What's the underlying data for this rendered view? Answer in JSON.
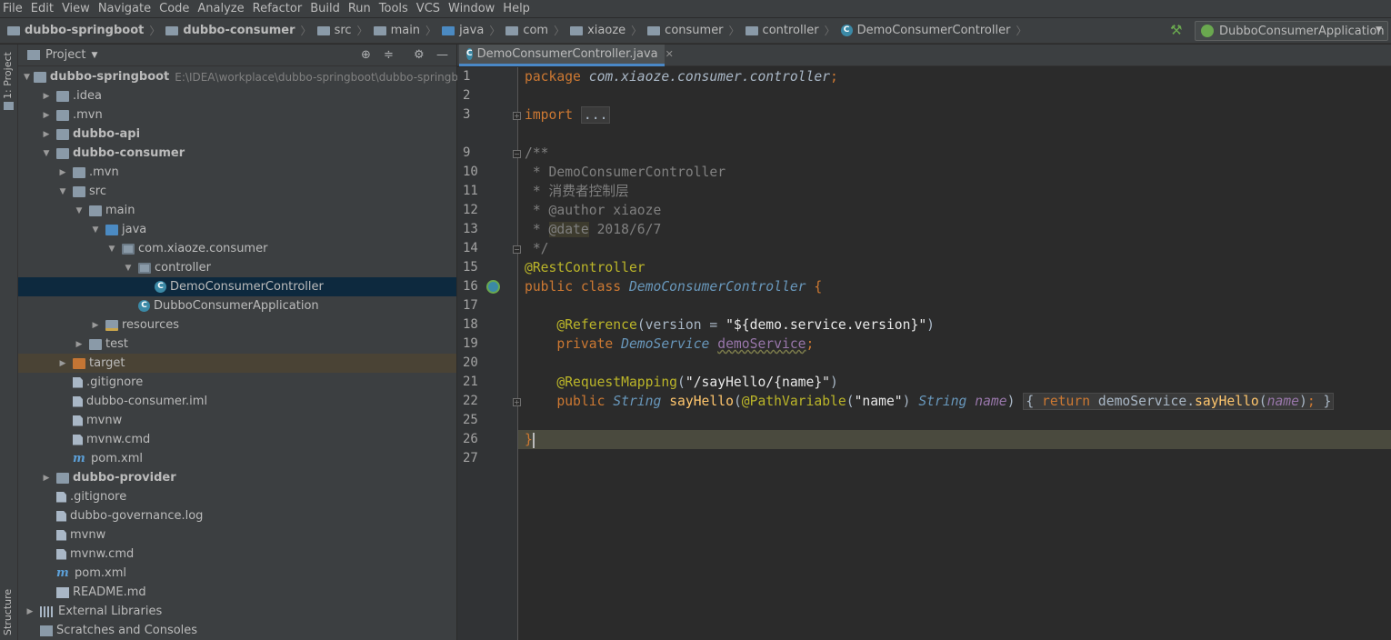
{
  "menu": [
    "File",
    "Edit",
    "View",
    "Navigate",
    "Code",
    "Analyze",
    "Refactor",
    "Build",
    "Run",
    "Tools",
    "VCS",
    "Window",
    "Help"
  ],
  "breadcrumbs": [
    "dubbo-springboot",
    "dubbo-consumer",
    "src",
    "main",
    "java",
    "com",
    "xiaoze",
    "consumer",
    "controller",
    "DemoConsumerController"
  ],
  "run_config": "DubboConsumerApplication",
  "left_stripe": {
    "project_tab": "1: Project",
    "structure_tab": "Structure"
  },
  "project_panel": {
    "title": "Project",
    "root_path": "E:\\IDEA\\workplace\\dubbo-springboot\\dubbo-springboo",
    "tree": [
      {
        "label": "dubbo-springboot",
        "bold": true,
        "icon": "module-folder",
        "toggle": "expanded"
      },
      {
        "label": ".idea",
        "icon": "folder",
        "toggle": "collapsed"
      },
      {
        "label": ".mvn",
        "icon": "folder",
        "toggle": "collapsed"
      },
      {
        "label": "dubbo-api",
        "bold": true,
        "icon": "module-folder",
        "toggle": "collapsed"
      },
      {
        "label": "dubbo-consumer",
        "bold": true,
        "icon": "module-folder",
        "toggle": "expanded"
      },
      {
        "label": ".mvn",
        "icon": "folder",
        "toggle": "collapsed"
      },
      {
        "label": "src",
        "icon": "folder",
        "toggle": "expanded"
      },
      {
        "label": "main",
        "icon": "folder",
        "toggle": "expanded"
      },
      {
        "label": "java",
        "icon": "source-folder",
        "toggle": "expanded"
      },
      {
        "label": "com.xiaoze.consumer",
        "icon": "package",
        "toggle": "expanded"
      },
      {
        "label": "controller",
        "icon": "package",
        "toggle": "expanded"
      },
      {
        "label": "DemoConsumerController",
        "icon": "class",
        "selected": true
      },
      {
        "label": "DubboConsumerApplication",
        "icon": "class"
      },
      {
        "label": "resources",
        "icon": "resources-folder",
        "toggle": "collapsed"
      },
      {
        "label": "test",
        "icon": "folder",
        "toggle": "collapsed"
      },
      {
        "label": "target",
        "icon": "excluded-folder",
        "toggle": "collapsed",
        "highlight": true
      },
      {
        "label": ".gitignore",
        "icon": "file"
      },
      {
        "label": "dubbo-consumer.iml",
        "icon": "file"
      },
      {
        "label": "mvnw",
        "icon": "file"
      },
      {
        "label": "mvnw.cmd",
        "icon": "file"
      },
      {
        "label": "pom.xml",
        "icon": "maven"
      },
      {
        "label": "dubbo-provider",
        "bold": true,
        "icon": "module-folder",
        "toggle": "collapsed"
      },
      {
        "label": ".gitignore",
        "icon": "file"
      },
      {
        "label": "dubbo-governance.log",
        "icon": "file"
      },
      {
        "label": "mvnw",
        "icon": "file"
      },
      {
        "label": "mvnw.cmd",
        "icon": "file"
      },
      {
        "label": "pom.xml",
        "icon": "maven"
      },
      {
        "label": "README.md",
        "icon": "markdown"
      },
      {
        "label": "External Libraries",
        "icon": "libraries",
        "toggle": "collapsed"
      },
      {
        "label": "Scratches and Consoles",
        "icon": "scratches"
      }
    ]
  },
  "editor": {
    "tab_label": "DemoConsumerController.java",
    "current_line": "26",
    "lines": [
      {
        "n": "1"
      },
      {
        "n": "2"
      },
      {
        "n": "3"
      },
      {
        "n": "9"
      },
      {
        "n": "10"
      },
      {
        "n": "11"
      },
      {
        "n": "12"
      },
      {
        "n": "13"
      },
      {
        "n": "14"
      },
      {
        "n": "15"
      },
      {
        "n": "16"
      },
      {
        "n": "17"
      },
      {
        "n": "18"
      },
      {
        "n": "19"
      },
      {
        "n": "20"
      },
      {
        "n": "21"
      },
      {
        "n": "22"
      },
      {
        "n": "25"
      },
      {
        "n": "26"
      },
      {
        "n": "27"
      }
    ],
    "code": {
      "l1_kw": "package",
      "l1_pkg": "com.xiaoze.consumer.controller",
      "l1_semi": ";",
      "l3_kw": "import",
      "l3_fold": "...",
      "l9": "/**",
      "l10": " * DemoConsumerController",
      "l11": " * 消费者控制层",
      "l12": " * @author xiaoze",
      "l13_pre": " * ",
      "l13_tag": "@date",
      "l13_post": " 2018/6/7",
      "l14": " */",
      "l15": "@RestController",
      "l16_kw": "public class",
      "l16_cls": "DemoConsumerController",
      "l16_brace": " {",
      "l18_an": "@Reference",
      "l18_open": "(version = ",
      "l18_str": "\"${demo.service.version}\"",
      "l18_close": ")",
      "l19_kw": "private",
      "l19_type": "DemoService",
      "l19_field": "demoService",
      "l19_semi": ";",
      "l21_an": "@RequestMapping",
      "l21_open": "(",
      "l21_str": "\"/sayHello/{name}\"",
      "l21_close": ")",
      "l22_kw": "public",
      "l22_type": "String",
      "l22_fn": "sayHello",
      "l22_an": "@PathVariable",
      "l22_str": "\"name\"",
      "l22_type2": "String",
      "l22_par": "name",
      "l22_ret": "return",
      "l22_call": "demoService",
      "l22_fn2": "sayHello",
      "l22_par2": "name",
      "l26": "}"
    }
  },
  "colors": {
    "keyword": "#cc7832",
    "annotation": "#bbb529",
    "comment": "#808080",
    "string": "#e8e8e8",
    "function": "#ffc66d",
    "field": "#9876aa",
    "selection": "#0d293e"
  }
}
